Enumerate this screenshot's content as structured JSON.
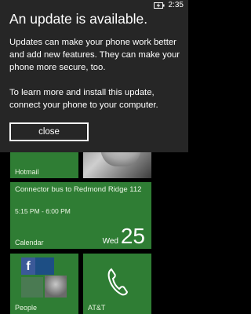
{
  "status_bar": {
    "time": "2:35",
    "battery_icon": "battery-charging-icon"
  },
  "notification": {
    "title": "An update is available.",
    "paragraphs": [
      "Updates can make your phone work better and add new features. They can make your phone more secure, too.",
      "To learn more and install this update, connect your phone to your computer."
    ],
    "close_label": "close"
  },
  "tiles": {
    "hotmail_label": "Hotmail",
    "calendar": {
      "event_title": "Connector bus to Redmond Ridge 112",
      "event_time": "5:15 PM - 6:00 PM",
      "label": "Calendar",
      "day": "Wed",
      "date": "25"
    },
    "people_label": "People",
    "phone_label": "AT&T",
    "people_icon": "facebook-icon",
    "phone_icon": "phone-icon"
  },
  "colors": {
    "tile_accent": "#2f7d34",
    "panel_background": "#262626",
    "screen_background": "#000000"
  }
}
